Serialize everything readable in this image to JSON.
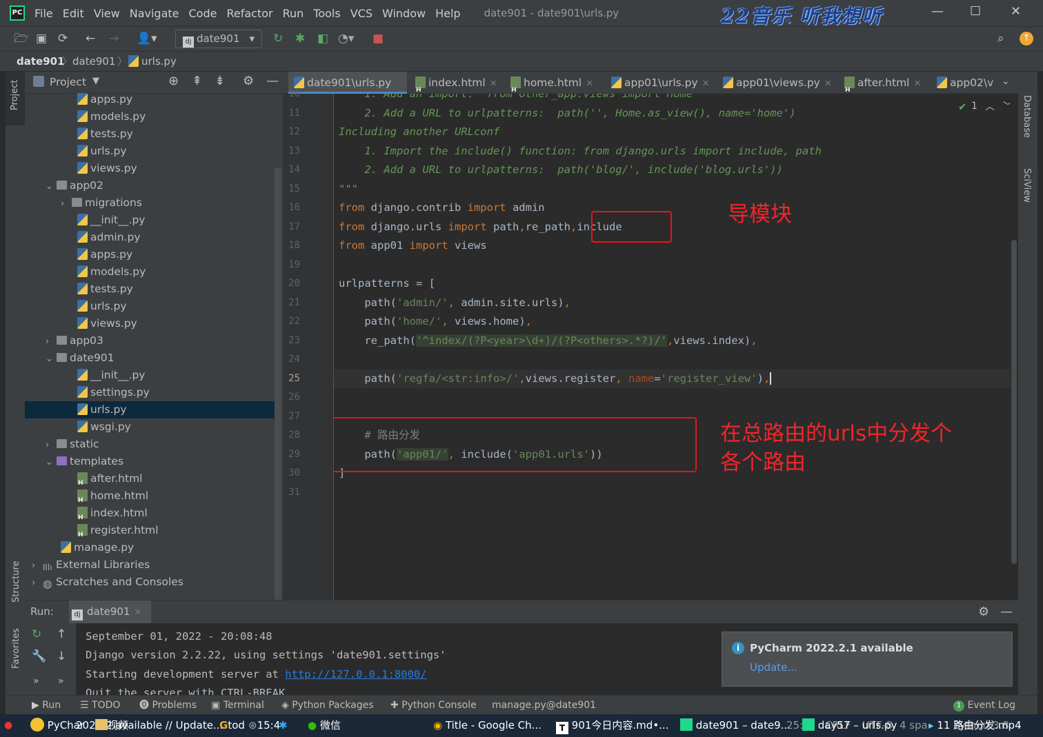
{
  "menu": [
    "File",
    "Edit",
    "View",
    "Navigate",
    "Code",
    "Refactor",
    "Run",
    "Tools",
    "VCS",
    "Window",
    "Help"
  ],
  "window_title": "date901 - date901\\urls.py",
  "brand_overlay": "22音乐 听我想听",
  "run_config": "date901",
  "breadcrumb": [
    "date901",
    "date901",
    "urls.py"
  ],
  "project_panel": {
    "title": "Project",
    "tree": [
      {
        "label": "apps.py",
        "type": "py",
        "indent": 3
      },
      {
        "label": "models.py",
        "type": "py",
        "indent": 3
      },
      {
        "label": "tests.py",
        "type": "py",
        "indent": 3
      },
      {
        "label": "urls.py",
        "type": "py",
        "indent": 3
      },
      {
        "label": "views.py",
        "type": "py",
        "indent": 3
      },
      {
        "label": "app02",
        "type": "folder",
        "indent": 1,
        "chev": "⌄"
      },
      {
        "label": "migrations",
        "type": "folder",
        "indent": 2,
        "chev": "›"
      },
      {
        "label": "__init__.py",
        "type": "py",
        "indent": 3
      },
      {
        "label": "admin.py",
        "type": "py",
        "indent": 3
      },
      {
        "label": "apps.py",
        "type": "py",
        "indent": 3
      },
      {
        "label": "models.py",
        "type": "py",
        "indent": 3
      },
      {
        "label": "tests.py",
        "type": "py",
        "indent": 3
      },
      {
        "label": "urls.py",
        "type": "py",
        "indent": 3
      },
      {
        "label": "views.py",
        "type": "py",
        "indent": 3
      },
      {
        "label": "app03",
        "type": "folder",
        "indent": 1,
        "chev": "›"
      },
      {
        "label": "date901",
        "type": "folder",
        "indent": 1,
        "chev": "⌄"
      },
      {
        "label": "__init__.py",
        "type": "py",
        "indent": 3
      },
      {
        "label": "settings.py",
        "type": "py",
        "indent": 3
      },
      {
        "label": "urls.py",
        "type": "py",
        "indent": 3,
        "selected": true
      },
      {
        "label": "wsgi.py",
        "type": "py",
        "indent": 3
      },
      {
        "label": "static",
        "type": "folder",
        "indent": 1,
        "chev": "›"
      },
      {
        "label": "templates",
        "type": "folderp",
        "indent": 1,
        "chev": "⌄"
      },
      {
        "label": "after.html",
        "type": "html",
        "indent": 3
      },
      {
        "label": "home.html",
        "type": "html",
        "indent": 3
      },
      {
        "label": "index.html",
        "type": "html",
        "indent": 3
      },
      {
        "label": "register.html",
        "type": "html",
        "indent": 3
      },
      {
        "label": "manage.py",
        "type": "py",
        "indent": 2
      },
      {
        "label": "External Libraries",
        "type": "lib",
        "indent": 0,
        "chev": "›"
      },
      {
        "label": "Scratches and Consoles",
        "type": "scratch",
        "indent": 0,
        "chev": "›"
      }
    ]
  },
  "editor_tabs": [
    {
      "label": "date901\\urls.py",
      "icon": "py",
      "active": true
    },
    {
      "label": "index.html",
      "icon": "html"
    },
    {
      "label": "home.html",
      "icon": "html"
    },
    {
      "label": "app01\\urls.py",
      "icon": "py"
    },
    {
      "label": "app01\\views.py",
      "icon": "py"
    },
    {
      "label": "after.html",
      "icon": "html"
    },
    {
      "label": "app02\\v",
      "icon": "py"
    }
  ],
  "inspection_count": "1",
  "line_numbers": [
    "10",
    "11",
    "12",
    "13",
    "14",
    "15",
    "16",
    "17",
    "18",
    "19",
    "20",
    "21",
    "22",
    "23",
    "24",
    "25",
    "26",
    "27",
    "28",
    "29",
    "30",
    "31"
  ],
  "current_line": "25",
  "annotations": {
    "import_note": "导模块",
    "dispatch_note_1": "在总路由的urls中分发个",
    "dispatch_note_2": "各个路由"
  },
  "run_panel": {
    "label": "Run:",
    "tab": "date901",
    "output": [
      "September 01, 2022 - 20:08:48",
      "Django version 2.2.22, using settings 'date901.settings'",
      "Starting development server at ",
      "Quit the server with CTRL-BREAK."
    ],
    "url": "http://127.0.0.1:8000/"
  },
  "notification": {
    "title": "PyCharm 2022.2.1 available",
    "link": "Update..."
  },
  "bottom_tabs": [
    "Run",
    "TODO",
    "Problems",
    "Terminal",
    "Python Packages",
    "Python Console",
    "manage.py@date901",
    "Event Log"
  ],
  "side_tabs": {
    "left_top": "Project",
    "left_mid": "Structure",
    "left_bot": "Favorites",
    "right_top": "Database",
    "right_mid": "SciView"
  },
  "taskbar": [
    "PyChar",
    "2022.2 available // Update...",
    "tod",
    "15:4",
    "视频",
    "微信",
    "Title - Google Ch...",
    "901今日内容.md•...",
    "date901 – date9...",
    "25:",
    "CRLF",
    "UTF-8",
    "4 spa",
    "day57 – urls.py",
    "Python 3.8",
    "11 路由分发.mp4"
  ]
}
